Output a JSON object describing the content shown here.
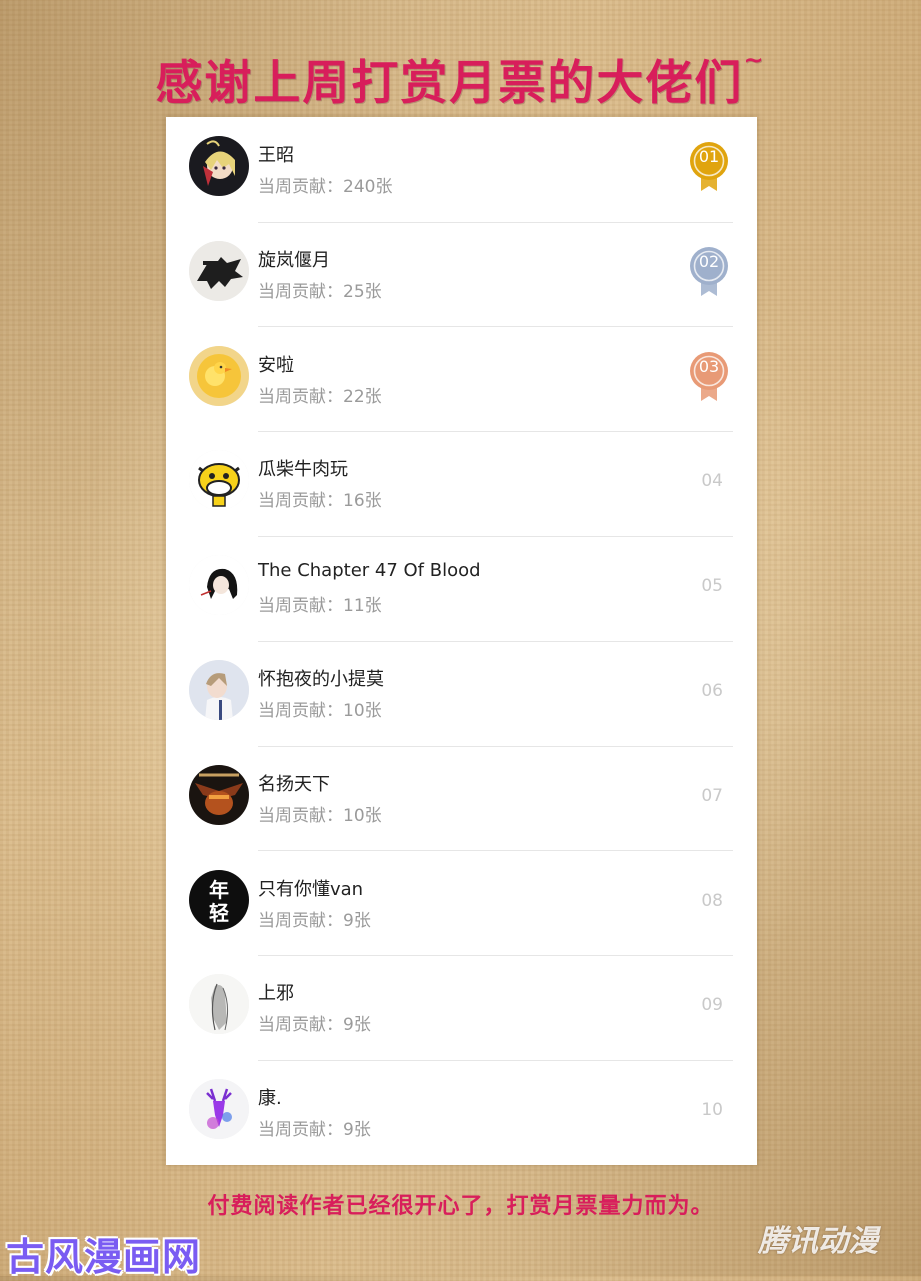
{
  "header": {
    "title": "感谢上周打赏月票的大佬们",
    "title_suffix": "~"
  },
  "ranking": {
    "rows": [
      {
        "rank": "01",
        "name": "王昭",
        "contribution": "当周贡献：240张",
        "medal": "gold",
        "avatar": "anime-girl-avatar"
      },
      {
        "rank": "02",
        "name": "旋岚偃月",
        "contribution": "当周贡献：25张",
        "medal": "silver",
        "avatar": "wolf-avatar"
      },
      {
        "rank": "03",
        "name": "安啦",
        "contribution": "当周贡献：22张",
        "medal": "bronze",
        "avatar": "yellow-duck-avatar"
      },
      {
        "rank": "04",
        "name": "瓜柴牛肉玩",
        "contribution": "当周贡献：16张",
        "medal": "",
        "avatar": "cartoon-cow-avatar"
      },
      {
        "rank": "05",
        "name": "The Chapter 47 Of Blood",
        "contribution": "当周贡献：11张",
        "medal": "",
        "avatar": "dark-hair-girl-avatar"
      },
      {
        "rank": "06",
        "name": "怀抱夜的小提莫",
        "contribution": "当周贡献：10张",
        "medal": "",
        "avatar": "anime-boy-avatar"
      },
      {
        "rank": "07",
        "name": "名扬天下",
        "contribution": "当周贡献：10张",
        "medal": "",
        "avatar": "warrior-avatar"
      },
      {
        "rank": "08",
        "name": "只有你懂van",
        "contribution": "当周贡献：9张",
        "medal": "",
        "avatar": "calligraphy-avatar",
        "avatar_text": "年轻"
      },
      {
        "rank": "09",
        "name": "上邪",
        "contribution": "当周贡献：9张",
        "medal": "",
        "avatar": "sketch-figure-avatar"
      },
      {
        "rank": "10",
        "name": "康.",
        "contribution": "当周贡献：9张",
        "medal": "",
        "avatar": "purple-deer-avatar"
      }
    ]
  },
  "footer": {
    "text": "付费阅读作者已经很开心了，打赏月票量力而为。"
  },
  "watermarks": {
    "left": "古风漫画网",
    "right": "腾讯动漫"
  },
  "colors": {
    "title": "#d81e5b",
    "gold": "#e0a40e",
    "silver": "#9fb0cc",
    "bronze": "#e89a76",
    "plain_rank": "#c9c9c9"
  }
}
